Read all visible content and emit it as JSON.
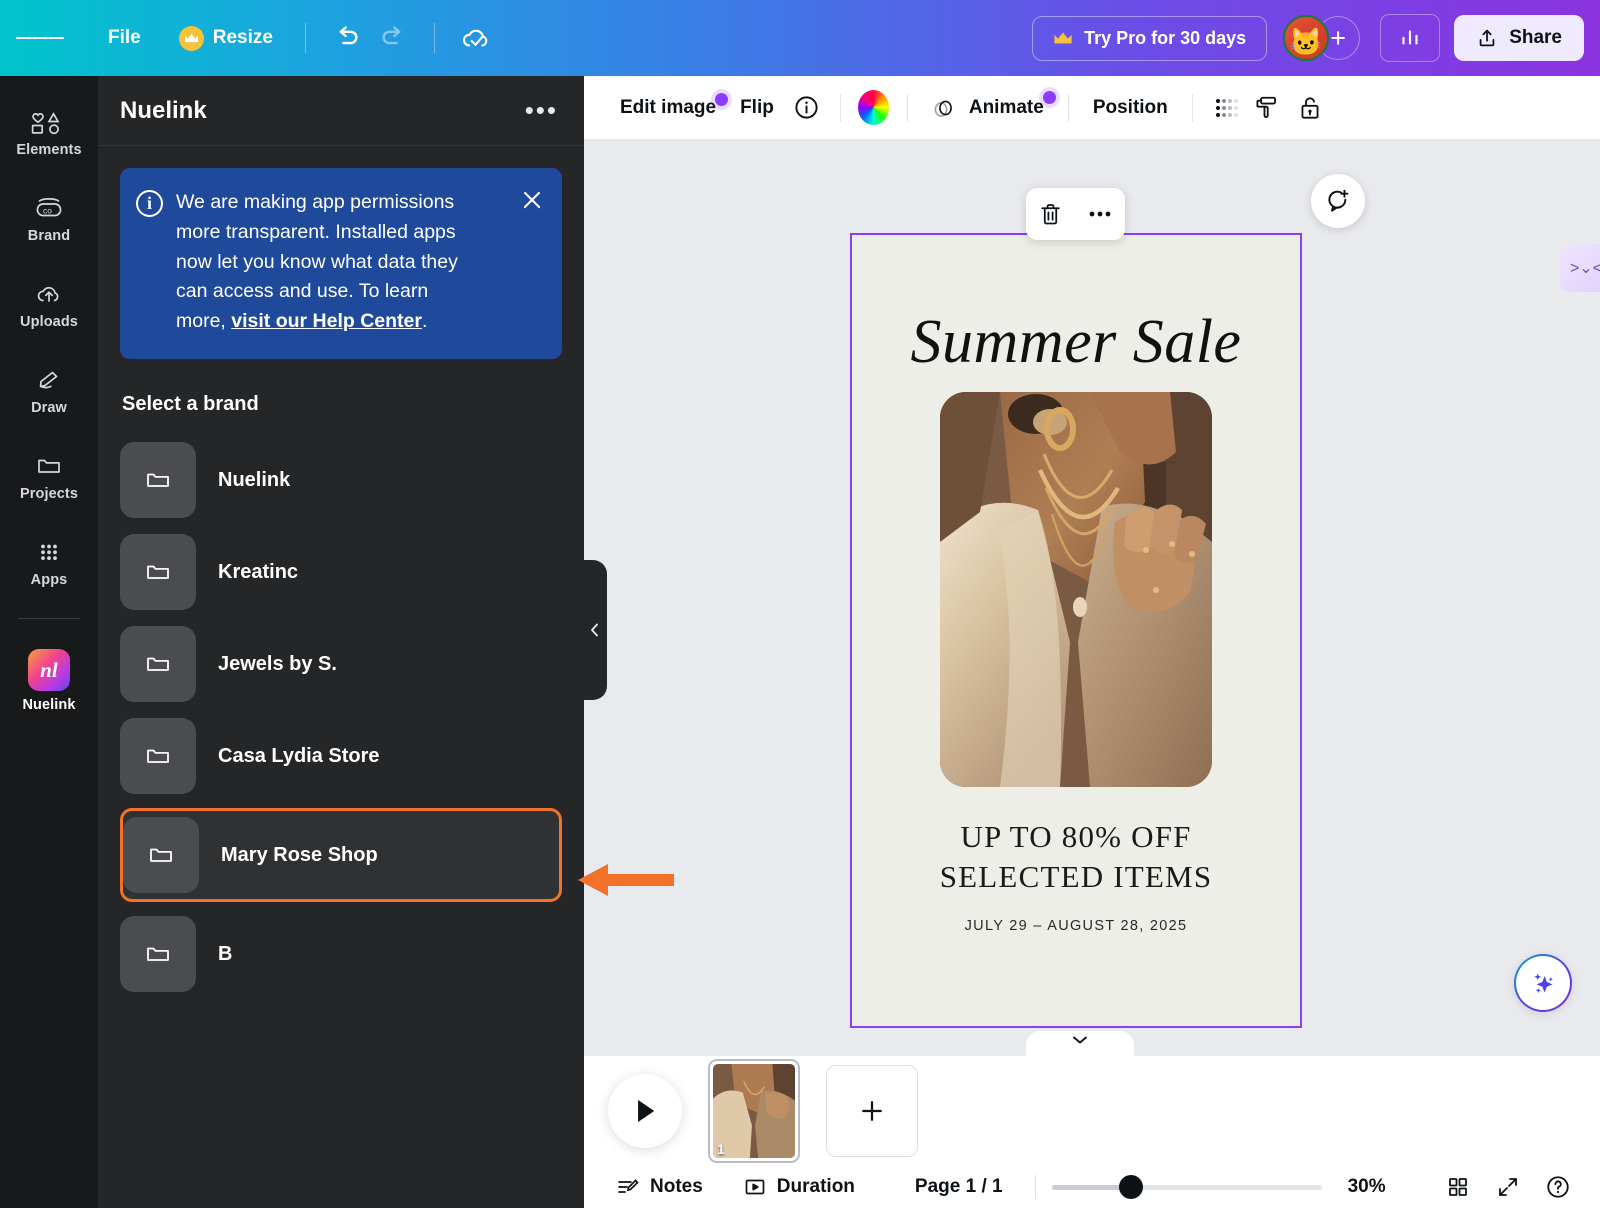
{
  "topbar": {
    "menu_icon": "hamburger-menu-icon",
    "file_label": "File",
    "resize_label": "Resize",
    "resize_badge_icon": "crown-icon",
    "undo_icon": "undo-icon",
    "redo_icon": "redo-icon",
    "cloud_icon": "cloud-saved-icon",
    "try_pro_label": "Try Pro for 30 days",
    "try_pro_icon": "crown-icon",
    "avatar_name": "user-avatar",
    "avatar_glyph": "🐱",
    "add_member_label": "+",
    "stats_icon": "bar-chart-icon",
    "share_label": "Share",
    "share_icon": "share-upload-icon",
    "gradient_from": "#00c4cc",
    "gradient_to": "#8b33e0"
  },
  "rail": {
    "items": [
      {
        "label": "Elements",
        "icon": "shapes-icon"
      },
      {
        "label": "Brand",
        "icon": "brand-co-icon"
      },
      {
        "label": "Uploads",
        "icon": "cloud-upload-icon"
      },
      {
        "label": "Draw",
        "icon": "pen-draw-icon"
      },
      {
        "label": "Projects",
        "icon": "folder-icon"
      },
      {
        "label": "Apps",
        "icon": "grid-apps-icon"
      }
    ],
    "active_app": {
      "label": "Nuelink",
      "icon": "nuelink-logo-icon",
      "monogram": "nl"
    }
  },
  "panel": {
    "title": "Nuelink",
    "more_icon": "more-options-icon",
    "collapse_icon": "chevron-left-icon",
    "notice": {
      "info_icon": "info-circle-icon",
      "text_before": "We are making app permissions more transparent. Installed apps now let you know what data they can access and use. To learn more, ",
      "link_text": "visit our Help Center",
      "text_after": ".",
      "close_icon": "close-x-icon",
      "bg_color": "#1f4a9c"
    },
    "select_brand_label": "Select a brand",
    "brands": [
      {
        "name": "Nuelink",
        "icon": "folder-icon",
        "highlighted": false
      },
      {
        "name": "Kreatinc",
        "icon": "folder-icon",
        "highlighted": false
      },
      {
        "name": "Jewels by S.",
        "icon": "folder-icon",
        "highlighted": false
      },
      {
        "name": "Casa Lydia Store",
        "icon": "folder-icon",
        "highlighted": false
      },
      {
        "name": "Mary Rose Shop",
        "icon": "folder-icon",
        "highlighted": true
      },
      {
        "name": "B",
        "icon": "folder-icon",
        "highlighted": false
      }
    ],
    "highlight_color": "#f2722b"
  },
  "canvas_toolbar": {
    "edit_image_label": "Edit image",
    "flip_label": "Flip",
    "info_icon": "info-circle-icon",
    "color_icon": "color-wheel-icon",
    "animate_label": "Animate",
    "animate_icon": "animate-icon",
    "position_label": "Position",
    "transparency_icon": "transparency-checker-icon",
    "paint_roller_icon": "paint-roller-icon",
    "lock_icon": "unlock-icon",
    "badge_color": "#8b3dff"
  },
  "design": {
    "title": "Summer Sale",
    "headline_line1": "UP TO 80% OFF",
    "headline_line2": "SELECTED ITEMS",
    "date_range": "JULY 29 – AUGUST 28, 2025",
    "background_color": "#eeeee8",
    "selection_color": "#8b3dff",
    "photo_alt": "woman wearing gold layered necklaces and beige blazer",
    "element_toolbar": {
      "delete_icon": "trash-icon",
      "more_icon": "more-options-icon"
    },
    "comment_icon": "add-comment-icon",
    "ai_icon": "magic-sparkle-icon",
    "kaomoji_tab": ">⌄<",
    "collapse_icon": "chevron-down-icon"
  },
  "pagestrip": {
    "play_icon": "play-icon",
    "thumbnail_number": "1",
    "add_page_label": "+",
    "add_page_icon": "plus-icon"
  },
  "bottombar": {
    "notes_label": "Notes",
    "notes_icon": "notes-icon",
    "duration_label": "Duration",
    "duration_icon": "duration-play-icon",
    "page_label": "Page 1 / 1",
    "zoom_value": "30%",
    "zoom_percent": 30,
    "grid_view_icon": "grid-view-icon",
    "fullscreen_icon": "expand-fullscreen-icon",
    "help_icon": "help-circle-icon"
  },
  "annotation": {
    "arrow_icon": "pointer-arrow-icon",
    "arrow_color": "#f2722b",
    "points_to": "Mary Rose Shop"
  }
}
